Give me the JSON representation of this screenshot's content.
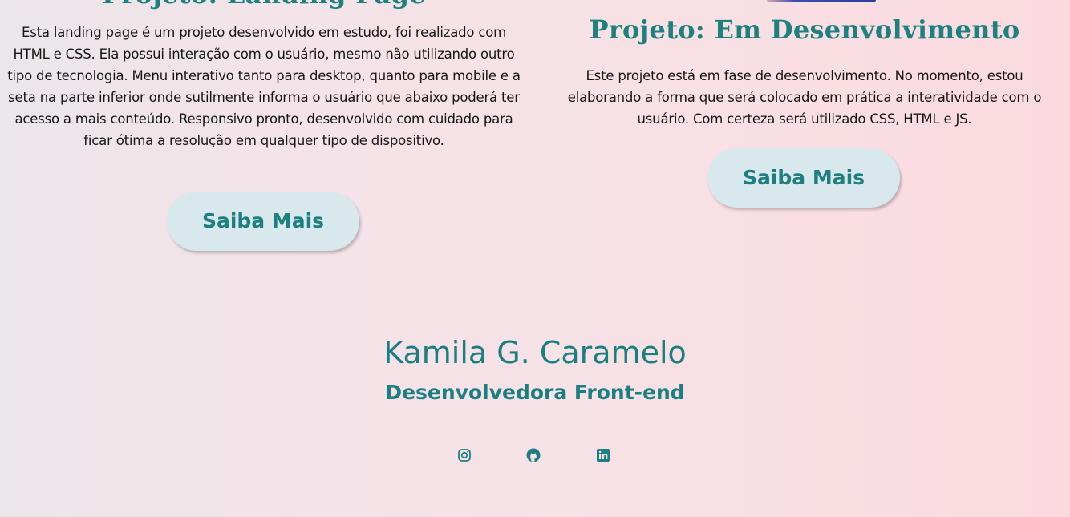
{
  "projects": [
    {
      "title": "Projeto: Landing Page",
      "description": "Esta landing page é um projeto desenvolvido em estudo, foi realizado com HTML e CSS. Ela possui interação com o usuário, mesmo não utilizando outro tipo de tecnologia. Menu interativo tanto para desktop, quanto para mobile e a seta na parte inferior onde sutilmente informa o usuário que abaixo poderá ter acesso a mais conteúdo. Responsivo pronto, desenvolvido com cuidado para ficar ótima a resolução em qualquer tipo de dispositivo.",
      "button_label": "Saiba Mais"
    },
    {
      "title": "Projeto: Em Desenvolvimento",
      "description": "Este projeto está em fase de desenvolvimento. No momento, estou elaborando a forma que será colocado em prática a interatividade com o usuário. Com certeza será utilizado CSS, HTML e JS.",
      "button_label": "Saiba Mais"
    }
  ],
  "footer": {
    "name": "Kamila G. Caramelo",
    "role": "Desenvolvedora Front-end",
    "social": [
      {
        "icon": "instagram-icon"
      },
      {
        "icon": "github-icon"
      },
      {
        "icon": "linkedin-icon"
      }
    ]
  },
  "colors": {
    "accent": "#1f8080",
    "button_bg": "#d8e8ec",
    "background_start": "#ebe6ea",
    "background_end": "#fadadf"
  }
}
